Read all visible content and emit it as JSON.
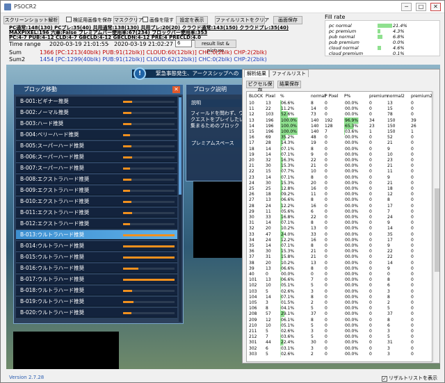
{
  "window": {
    "title": "PSOCR2",
    "minimize": "─",
    "maximize": "□",
    "close": "✕"
  },
  "toolbar": {
    "screenshot": "スクリーンショット解析",
    "save_check": "検証用画像を保存",
    "mask_clear": "マスククリア",
    "hide_image": "画像を隠す",
    "show_settings": "設定を表示",
    "clear_filelist": "ファイルリストをクリア",
    "save_image": "画面保存"
  },
  "info_lines": [
    "PC通常:148(130) PCプレ:35(40) 共用通常:138(130) 共用プレ:20(20) クラウド通常:143(150) クラウドプレ:35(40)",
    "MAXPIXEL:196 六華:False プレミアムバー使用率:67(234) ブロックバー使用率:353",
    "PC:4-7 PUB:4-12 CLD:4-7 GBCLD:4-12 GBCLDN:4-12 PRE:4 PRECLD:4.0"
  ],
  "time_range": {
    "label": "Time range",
    "start": "2020-03-19 21:01:55",
    "end": "2020-03-19 21:02:27",
    "input": "6",
    "button": "result list & picture"
  },
  "sum": {
    "label": "Sum",
    "total": "1366",
    "pc": "[PC:1213(40blk)",
    "pub": "PUB:91(12blk)]",
    "cloud": "CLOUD:60(12blk)]",
    "chc": "CHC:0(2blk)",
    "chp": "CHP:2(2blk)"
  },
  "sum2": {
    "label": "Sum2",
    "total": "1454",
    "pc": "[PC:1299(40blk)",
    "pub": "PUB:91(12blk)]",
    "cloud": "CLOUD:62(12blk)]",
    "chc": "CHC:0(2blk)",
    "chp": "CHP:2(2blk)"
  },
  "fill_rate": {
    "title": "Fill rate",
    "rows": [
      {
        "name": "pc normal",
        "value": "21.4%",
        "ratio": 0.214
      },
      {
        "name": "pc premium",
        "value": "4.3%",
        "ratio": 0.043
      },
      {
        "name": "pub normal",
        "value": "6.8%",
        "ratio": 0.068
      },
      {
        "name": "pub premium",
        "value": "0.0%",
        "ratio": 0.0
      },
      {
        "name": "cloud normal",
        "value": "4.6%",
        "ratio": 0.046
      },
      {
        "name": "cloud premium",
        "value": "0.1%",
        "ratio": 0.001
      }
    ]
  },
  "game": {
    "notice": "緊急事態発生、アークスシップへの",
    "notice_icon": "!",
    "block_panel": {
      "title": "ブロック移動",
      "close": "✕",
      "rows": [
        {
          "label": "B-001:ビギナー推奨",
          "level": 0.18
        },
        {
          "label": "B-002:ノーマル推奨",
          "level": 0.16
        },
        {
          "label": "B-003:ハード推奨",
          "level": 0.16
        },
        {
          "label": "B-004:ベリーハード推奨",
          "level": 0.14
        },
        {
          "label": "B-005:スーパーハード推奨",
          "level": 0.16
        },
        {
          "label": "B-006:スーパーハード推奨",
          "level": 0.18
        },
        {
          "label": "B-007:スーパーハード推奨",
          "level": 0.14
        },
        {
          "label": "B-008:エクストラハード推奨",
          "level": 0.16
        },
        {
          "label": "B-009:エクストラハード推奨",
          "level": 0.14
        },
        {
          "label": "B-010:エクストラハード推奨",
          "level": 0.16
        },
        {
          "label": "B-011:エクストラハード推奨",
          "level": 0.18
        },
        {
          "label": "B-012:エクストラハード推奨",
          "level": 0.14
        },
        {
          "label": "B-013:ウルトラハード推奨",
          "level": 1.0
        },
        {
          "label": "B-014:ウルトラハード推奨",
          "level": 1.0
        },
        {
          "label": "B-015:ウルトラハード推奨",
          "level": 1.0
        },
        {
          "label": "B-016:ウルトラハード推奨",
          "level": 0.3
        },
        {
          "label": "B-017:ウルトラハード推奨",
          "level": 1.0
        },
        {
          "label": "B-018:ウルトラハード推奨",
          "level": 0.18
        },
        {
          "label": "B-019:ウルトラハード推奨",
          "level": 0.2
        },
        {
          "label": "B-020:ウルトラハード推奨",
          "level": 0.16
        }
      ]
    },
    "desc_panel": {
      "title": "ブロック説明",
      "sub": "説明",
      "text": "フィールドを問わず、ウ\nクエストをプレイしたい\n集まるためのブロック",
      "sub2": "プレミアムスペース"
    }
  },
  "result": {
    "tabs": [
      "解析結果",
      "ファイルリスト"
    ],
    "buttons": [
      "ピクセル保存",
      "結果保存"
    ],
    "columns": [
      "BLOCK",
      "Pixel",
      "%",
      "normal",
      "P Pixel",
      "P%",
      "premium",
      "normal2",
      "premium2"
    ],
    "rows": [
      [
        "10",
        "13",
        "06.6%",
        "8",
        "0",
        "00.0%",
        "0",
        "13",
        "0"
      ],
      [
        "11",
        "22",
        "11.2%",
        "14",
        "0",
        "00.0%",
        "0",
        "15",
        "0"
      ],
      [
        "12",
        "103",
        "52.6%",
        "73",
        "0",
        "00.0%",
        "0",
        "78",
        "0"
      ],
      [
        "13",
        "196",
        "100.0%",
        "140",
        "192",
        "96.9%",
        "34",
        "150",
        "39"
      ],
      [
        "14",
        "196",
        "100.0%",
        "140",
        "128",
        "65.3%",
        "23",
        "150",
        "26"
      ],
      [
        "15",
        "196",
        "100.0%",
        "140",
        "7",
        "03.6%",
        "1",
        "150",
        "1"
      ],
      [
        "16",
        "69",
        "35.2%",
        "48",
        "0",
        "00.0%",
        "0",
        "52",
        "0"
      ],
      [
        "17",
        "28",
        "14.3%",
        "19",
        "0",
        "00.0%",
        "0",
        "21",
        "0"
      ],
      [
        "18",
        "14",
        "07.1%",
        "8",
        "0",
        "00.0%",
        "0",
        "9",
        "0"
      ],
      [
        "19",
        "14",
        "07.1%",
        "9",
        "0",
        "00.0%",
        "0",
        "10",
        "0"
      ],
      [
        "20",
        "32",
        "16.3%",
        "22",
        "0",
        "00.0%",
        "0",
        "23",
        "0"
      ],
      [
        "21",
        "30",
        "15.3%",
        "21",
        "0",
        "00.0%",
        "0",
        "21",
        "0"
      ],
      [
        "22",
        "15",
        "07.7%",
        "10",
        "0",
        "00.0%",
        "0",
        "11",
        "0"
      ],
      [
        "23",
        "14",
        "07.1%",
        "8",
        "0",
        "00.0%",
        "0",
        "9",
        "0"
      ],
      [
        "24",
        "30",
        "15.3%",
        "20",
        "0",
        "00.0%",
        "0",
        "21",
        "0"
      ],
      [
        "25",
        "25",
        "12.8%",
        "16",
        "0",
        "00.0%",
        "0",
        "18",
        "0"
      ],
      [
        "26",
        "18",
        "09.2%",
        "11",
        "0",
        "00.0%",
        "0",
        "12",
        "0"
      ],
      [
        "27",
        "13",
        "06.6%",
        "8",
        "0",
        "00.0%",
        "0",
        "8",
        "0"
      ],
      [
        "28",
        "24",
        "12.2%",
        "16",
        "0",
        "00.0%",
        "0",
        "17",
        "0"
      ],
      [
        "29",
        "11",
        "05.6%",
        "6",
        "0",
        "00.0%",
        "0",
        "7",
        "0"
      ],
      [
        "30",
        "33",
        "16.8%",
        "22",
        "0",
        "00.0%",
        "0",
        "24",
        "0"
      ],
      [
        "31",
        "14",
        "07.1%",
        "8",
        "0",
        "00.0%",
        "0",
        "9",
        "0"
      ],
      [
        "32",
        "20",
        "10.2%",
        "13",
        "0",
        "00.0%",
        "0",
        "14",
        "0"
      ],
      [
        "33",
        "47",
        "24.0%",
        "33",
        "0",
        "00.0%",
        "0",
        "35",
        "0"
      ],
      [
        "34",
        "24",
        "12.2%",
        "16",
        "0",
        "00.0%",
        "0",
        "17",
        "0"
      ],
      [
        "35",
        "14",
        "07.1%",
        "8",
        "0",
        "00.0%",
        "0",
        "9",
        "0"
      ],
      [
        "36",
        "30",
        "15.3%",
        "21",
        "0",
        "00.0%",
        "0",
        "22",
        "0"
      ],
      [
        "37",
        "31",
        "15.8%",
        "21",
        "0",
        "00.0%",
        "0",
        "22",
        "0"
      ],
      [
        "38",
        "20",
        "10.2%",
        "13",
        "0",
        "00.0%",
        "0",
        "14",
        "0"
      ],
      [
        "39",
        "13",
        "06.6%",
        "8",
        "0",
        "00.0%",
        "0",
        "9",
        "0"
      ],
      [
        "40",
        "0",
        "00.0%",
        "0",
        "0",
        "00.0%",
        "0",
        "0",
        "0"
      ],
      [
        "101",
        "13",
        "06.6%",
        "7",
        "0",
        "00.0%",
        "0",
        "8",
        "0"
      ],
      [
        "102",
        "10",
        "05.1%",
        "5",
        "0",
        "00.0%",
        "0",
        "6",
        "0"
      ],
      [
        "103",
        "5",
        "02.6%",
        "3",
        "0",
        "00.0%",
        "0",
        "3",
        "0"
      ],
      [
        "104",
        "14",
        "07.1%",
        "8",
        "0",
        "00.0%",
        "0",
        "8",
        "0"
      ],
      [
        "105",
        "3",
        "01.5%",
        "2",
        "0",
        "00.0%",
        "0",
        "2",
        "0"
      ],
      [
        "106",
        "8",
        "04.1%",
        "5",
        "0",
        "00.0%",
        "0",
        "5",
        "0"
      ],
      [
        "208",
        "57",
        "29.1%",
        "37",
        "0",
        "00.0%",
        "0",
        "37",
        "0"
      ],
      [
        "209",
        "12",
        "06.1%",
        "8",
        "0",
        "00.0%",
        "0",
        "8",
        "0"
      ],
      [
        "210",
        "10",
        "05.1%",
        "5",
        "0",
        "00.0%",
        "0",
        "6",
        "0"
      ],
      [
        "211",
        "5",
        "02.6%",
        "3",
        "0",
        "00.0%",
        "0",
        "3",
        "0"
      ],
      [
        "212",
        "7",
        "03.6%",
        "5",
        "0",
        "00.0%",
        "0",
        "5",
        "0"
      ],
      [
        "301",
        "44",
        "22.4%",
        "30",
        "0",
        "00.0%",
        "0",
        "31",
        "0"
      ],
      [
        "302",
        "6",
        "03.1%",
        "3",
        "0",
        "00.0%",
        "0",
        "3",
        "0"
      ],
      [
        "303",
        "5",
        "02.6%",
        "2",
        "0",
        "00.0%",
        "0",
        "3",
        "0"
      ]
    ]
  },
  "bottom_check": "リザルトリストを表示",
  "bottom_check_mark": "✓",
  "version": "Version 2.7.28",
  "colors": {
    "sum_total": "#c00000",
    "sum2_total": "#2040c0",
    "highlight": "#8fe08f",
    "gauge": "#f0901e"
  }
}
